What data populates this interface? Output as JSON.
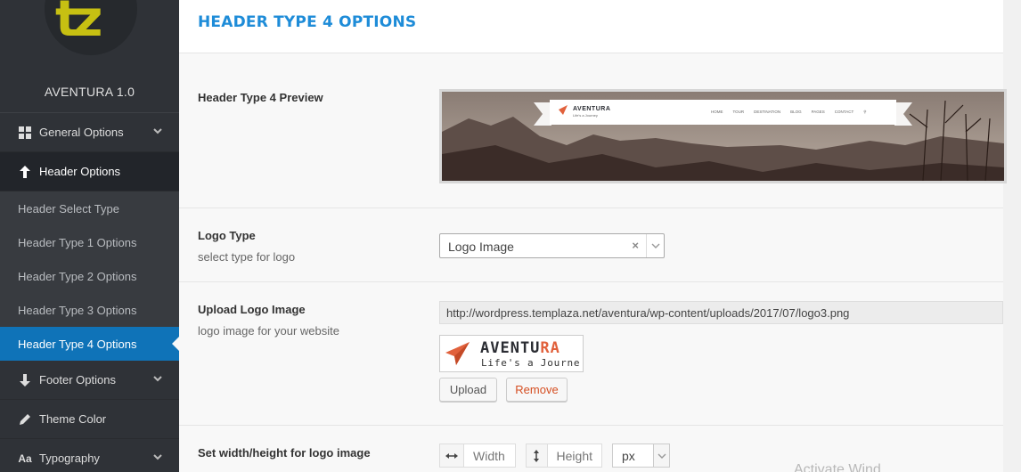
{
  "sidebar": {
    "logo_text": "tz",
    "brand": "AVENTURA 1.0",
    "items": [
      {
        "label": "General Options",
        "icon": "grid-icon",
        "has_chevron": true
      },
      {
        "label": "Header Options",
        "icon": "arrow-up-icon",
        "active": true
      },
      {
        "label": "Header Select Type",
        "sub": true
      },
      {
        "label": "Header Type 1 Options",
        "sub": true
      },
      {
        "label": "Header Type 2 Options",
        "sub": true
      },
      {
        "label": "Header Type 3 Options",
        "sub": true
      },
      {
        "label": "Header Type 4 Options",
        "sub": true,
        "current": true
      },
      {
        "label": "Footer Options",
        "icon": "arrow-down-icon",
        "has_chevron": true
      },
      {
        "label": "Theme Color",
        "icon": "pencil-icon"
      },
      {
        "label": "Typography",
        "icon": "font-icon",
        "has_chevron": true
      }
    ]
  },
  "main": {
    "title": "HEADER TYPE 4 OPTIONS",
    "preview": {
      "label": "Header Type 4 Preview",
      "logo_name": "AVENTURA",
      "logo_tagline": "Life's a Journey",
      "menu": [
        "HOME",
        "TOUR",
        "DESTINATION",
        "BLOG",
        "PAGES",
        "CONTACT"
      ]
    },
    "logo_type": {
      "label": "Logo Type",
      "desc": "select type for logo",
      "value": "Logo Image",
      "clear": "×"
    },
    "upload": {
      "label": "Upload Logo Image",
      "desc": "logo image for your website",
      "url": "http://wordpress.templaza.net/aventura/wp-content/uploads/2017/07/logo3.png",
      "thumb_word_a": "AVENTU",
      "thumb_word_b": "RA",
      "thumb_tag": "Life's a Journe",
      "upload_btn": "Upload",
      "remove_btn": "Remove"
    },
    "dimensions": {
      "label": "Set width/height for logo image",
      "width_placeholder": "Width",
      "height_placeholder": "Height",
      "unit": "px"
    }
  },
  "watermark": "Activate Wind",
  "colors": {
    "accent": "#1e8cd8",
    "sidebar_bg": "#2f3237",
    "current_item": "#0f73b8",
    "logo_yellow": "#c7c012",
    "remove_red": "#d54e21"
  }
}
